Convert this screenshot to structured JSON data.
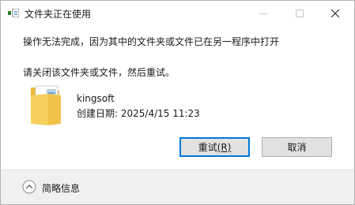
{
  "window": {
    "title": "文件夹正在使用"
  },
  "message": {
    "line1": "操作无法完成，因为其中的文件夹或文件已在另一程序中打开",
    "line2": "请关闭该文件夹或文件，然后重试。"
  },
  "item": {
    "name": "kingsoft",
    "date_label": "创建日期:",
    "date_value": "2025/4/15 11:23"
  },
  "buttons": {
    "retry": "重试",
    "retry_mnemonic": "(R)",
    "cancel": "取消"
  },
  "footer": {
    "details_label": "简略信息"
  },
  "icons": {
    "app": "file-move-icon",
    "minimize": "minimize-icon",
    "maximize": "maximize-icon",
    "close": "close-icon",
    "folder": "folder-icon",
    "expander": "chevron-up-icon"
  }
}
